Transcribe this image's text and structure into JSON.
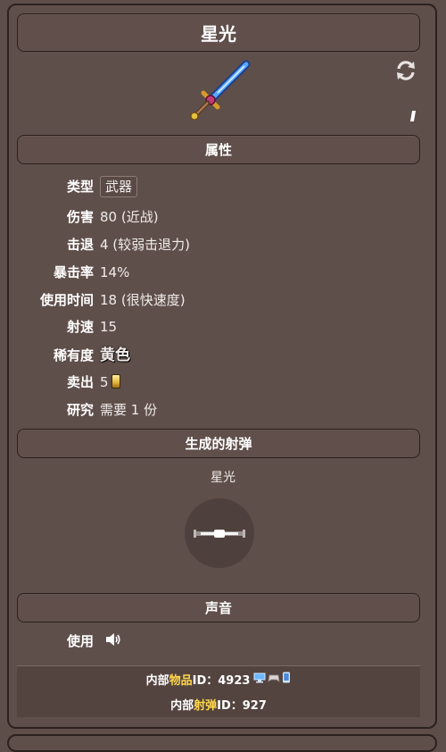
{
  "header": {
    "title": "星光"
  },
  "item": {
    "stack_mark": "1",
    "icon": "starlight-sword-icon"
  },
  "sections": {
    "attributes": "属性",
    "projectile": "生成的射弹",
    "sound": "声音"
  },
  "attributes": {
    "type_label": "类型",
    "type_value": "武器",
    "damage_label": "伤害",
    "damage_value": "80 (近战)",
    "knockback_label": "击退",
    "knockback_value": "4 (较弱击退力)",
    "crit_label": "暴击率",
    "crit_value": "14%",
    "usetime_label": "使用时间",
    "usetime_value": "18 (很快速度)",
    "velocity_label": "射速",
    "velocity_value": "15",
    "rarity_label": "稀有度",
    "rarity_value": "黄色",
    "sell_label": "卖出",
    "sell_value": "5",
    "research_label": "研究",
    "research_value": "需要 1 份"
  },
  "projectile": {
    "name": "星光"
  },
  "sound": {
    "use_label": "使用"
  },
  "footer": {
    "item_id_prefix": "内部",
    "item_id_link": "物品",
    "item_id_suffix": " ID：4923",
    "proj_id_prefix": "内部",
    "proj_id_link": "射弹",
    "proj_id_suffix": " ID：927"
  },
  "colors": {
    "background": "#5e4e49",
    "rarity_yellow": "#ffee3a",
    "research_pink": "#ff5fc8",
    "link_yellow": "#ffd84a"
  }
}
